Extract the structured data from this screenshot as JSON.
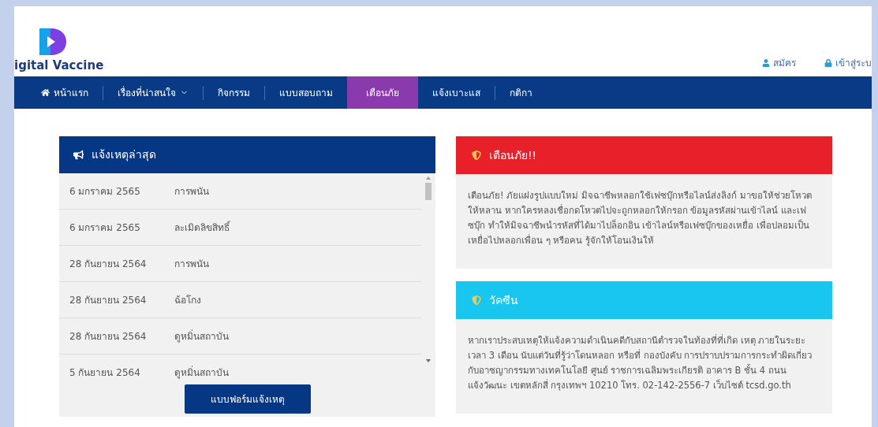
{
  "header": {
    "logo_text": "igital Vaccine",
    "links": [
      {
        "kind": "user",
        "label": "สมัคร"
      },
      {
        "kind": "lock",
        "label": "เข้าสู่ระบ"
      }
    ]
  },
  "nav": [
    {
      "label": "หน้าแรก",
      "kind": "home",
      "selected": false
    },
    {
      "label": "เรื่องที่น่าสนใจ",
      "kind": "dropdown",
      "selected": false
    },
    {
      "label": "กิจกรรม",
      "kind": "plain",
      "selected": false
    },
    {
      "label": "แบบสอบถาม",
      "kind": "plain",
      "selected": false
    },
    {
      "label": "เตือนภัย",
      "kind": "plain",
      "selected": true
    },
    {
      "label": "แจ้งเบาะแส",
      "kind": "plain",
      "selected": false
    },
    {
      "label": "กติกา",
      "kind": "plain",
      "selected": false
    }
  ],
  "reports": {
    "title": "แจ้งเหตุล่าสุด",
    "rows": [
      {
        "date": "6 มกราคม 2565",
        "category": "การพนัน"
      },
      {
        "date": "6 มกราคม 2565",
        "category": "ละเมิดลิขสิทธิ์"
      },
      {
        "date": "28 กันยายน 2564",
        "category": "การพนัน"
      },
      {
        "date": "28 กันยายน 2564",
        "category": "ฉ้อโกง"
      },
      {
        "date": "28 กันยายน 2564",
        "category": "ดูหมิ่นสถาบัน"
      },
      {
        "date": "5 กันยายน 2564",
        "category": "ดูหมิ่นสถาบัน"
      }
    ],
    "button": "แบบฟอร์มแจ้งเหตุ"
  },
  "notices": [
    {
      "title": "เตือนภัย!!",
      "color": "#e8202a",
      "text": "เตือนภัย! ภัยแฝงรูปแบบใหม่ มิจฉาชีพหลอกใช้เฟซบุ๊กหรือไลน์ส่งลิงก์ มาขอให้ช่วยโหวตให้หลาน หากใครหลงเชื่อกดโหวตไปจะถูกหลอกให้กรอก ข้อมูลรหัสผ่านเข้าไลน์ และเฟซบุ๊ก ทำให้มิจฉาชีพนำรหัสที่ได้มาไปล็อกอิน เข้าไลน์หรือเฟซบุ๊กของเหยื่อ เพื่อปลอมเป็นเหยื่อไปหลอกเพื่อน ๆ หรือคน รู้จักให้โอนเงินให้"
    },
    {
      "title": "วัคซีน",
      "color": "#18c6ef",
      "text": "หากเราประสบเหตุให้แจ้งความดำเนินคดีกับสถานีตำรวจในท้องที่ที่เกิด เหตุ ภายในระยะเวลา 3 เดือน นับแต่วันที่รู้ว่าโดนหลอก หรือที่ กองบังคับ การปราบปรามการกระทำผิดเกี่ยวกับอาชญากรรมทางเทคโนโลยี ศูนย์ ราชการเฉลิมพระเกียรติ อาคาร B ชั้น 4 ถนนแจ้งวัฒนะ เขตหลักสี่ กรุงเทพฯ 10210 โทร. 02-142-2556-7 เว็บไซต์ tcsd.go.th"
    }
  ]
}
